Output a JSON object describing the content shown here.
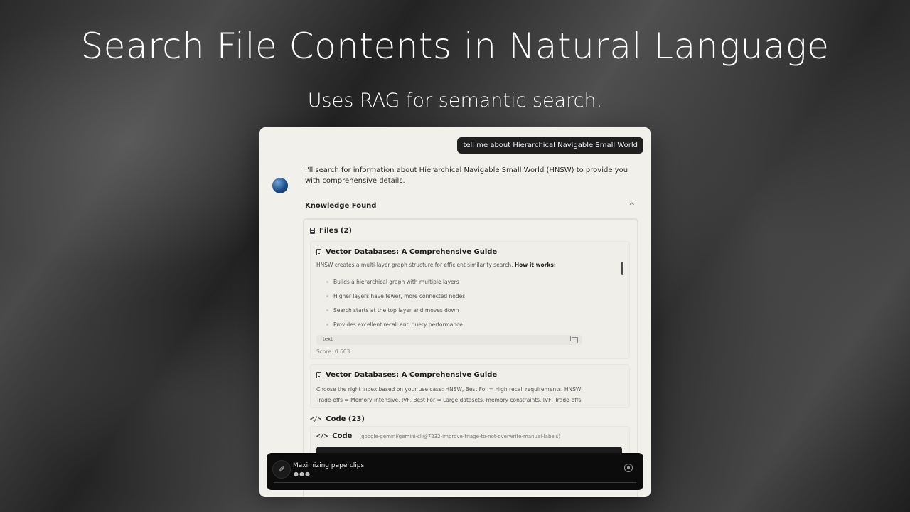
{
  "hero": {
    "title": "Search File Contents in Natural Language",
    "subtitle": "Uses RAG for semantic search."
  },
  "chat": {
    "user_message": "tell me about Hierarchical Navigable Small World",
    "assistant_message": "I'll search for information about Hierarchical Navigable Small World (HNSW) to provide you with comprehensive details."
  },
  "knowledge": {
    "header": "Knowledge Found",
    "files_label": "Files (2)",
    "files": [
      {
        "title": "Vector Databases: A Comprehensive Guide",
        "intro": "HNSW creates a multi-layer graph structure for efficient similarity search.",
        "intro_bold": "How it works:",
        "bullets": [
          "Builds a hierarchical graph with multiple layers",
          "Higher layers have fewer, more connected nodes",
          "Search starts at the top layer and moves down",
          "Provides excellent recall and query performance"
        ],
        "code_lang": "text",
        "score": "Score: 0.603"
      },
      {
        "title": "Vector Databases: A Comprehensive Guide",
        "body": "Choose the right index based on your use case: HNSW, Best For = High recall requirements. HNSW, Trade-offs = Memory intensive. IVF, Best For = Large datasets, memory constraints. IVF, Trade-offs = Requires parameter tuning. LSH, Best For = Very fast queries, approximate results. LSH, Trade-offs ="
      }
    ],
    "code_label": "Code (23)",
    "code_item": {
      "title": "Code",
      "branch": "(google-gemini/gemini-cli@7232-improve-triage-to-not-overwrite-manual-labels)"
    }
  },
  "status": {
    "text": "Maximizing paperclips",
    "dots": "●●●"
  },
  "icons": [
    "paperclip-icon",
    "stop-icon",
    "file-icon",
    "code-icon",
    "chevron-up-icon",
    "copy-icon"
  ]
}
